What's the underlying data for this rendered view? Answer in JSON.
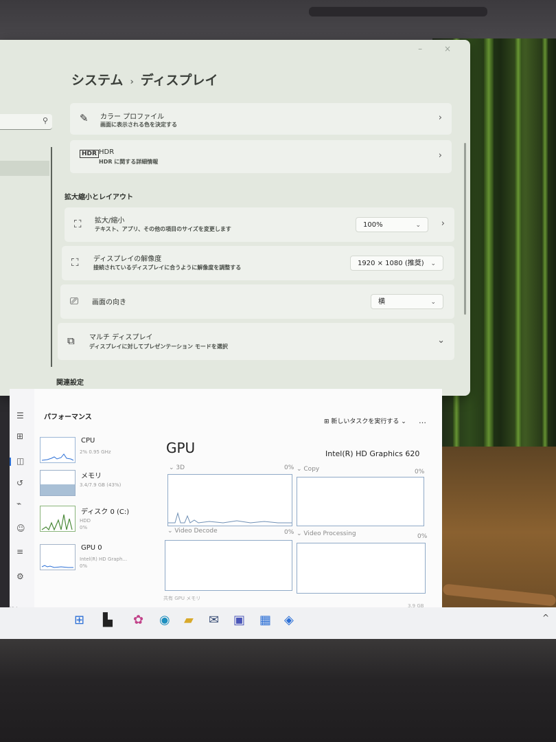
{
  "settings": {
    "breadcrumb": {
      "root": "システム",
      "sep": "›",
      "current": "ディスプレイ"
    },
    "cards": {
      "color_profile": {
        "title": "カラー プロファイル",
        "subtitle": "画面に表示される色を決定する",
        "icon": "pen-icon"
      },
      "hdr": {
        "title": "HDR",
        "subtitle": "HDR に関する詳細情報",
        "icon": "hdr-icon"
      }
    },
    "section_scale_layout": "拡大縮小とレイアウト",
    "scale": {
      "title": "拡大/縮小",
      "subtitle": "テキスト、アプリ、その他の項目のサイズを変更します",
      "value": "100%",
      "icon": "scale-icon"
    },
    "resolution": {
      "title": "ディスプレイの解像度",
      "subtitle": "接続されているディスプレイに合うように解像度を調整する",
      "value": "1920 × 1080 (推奨)",
      "icon": "resolution-icon"
    },
    "orientation": {
      "title": "画面の向き",
      "value": "横",
      "icon": "orientation-icon"
    },
    "multi": {
      "title": "マルチ ディスプレイ",
      "subtitle": "ディスプレイに対してプレゼンテーション モードを選択",
      "icon": "multi-display-icon"
    },
    "section_related": "関連設定"
  },
  "taskmgr": {
    "page_title": "パフォーマンス",
    "new_task": "新しいタスクを実行する",
    "more": "…",
    "sidebar": [
      {
        "name": "CPU",
        "stat": "2% 0.95 GHz"
      },
      {
        "name": "メモリ",
        "stat": "3.4/7.9 GB (43%)"
      },
      {
        "name": "ディスク 0 (C:)",
        "stat": "HDD",
        "stat2": "0%"
      },
      {
        "name": "GPU 0",
        "stat": "Intel(R) HD Graph...",
        "stat2": "0%"
      }
    ],
    "gpu_title": "GPU",
    "gpu_model": "Intel(R) HD Graphics 620",
    "graphs": [
      {
        "label": "⌄ 3D",
        "pct": "0%"
      },
      {
        "label": "⌄ Copy",
        "pct": "0%"
      },
      {
        "label": "⌄ Video Decode",
        "pct": "0%"
      },
      {
        "label": "⌄ Video Processing",
        "pct": "0%"
      }
    ],
    "footer_label": "共有 GPU メモリ",
    "footer_value": "3.9 GB",
    "status_left": "設定"
  },
  "taskbar": {
    "icons": [
      "start-icon",
      "widgets-icon",
      "copilot-icon",
      "edge-icon",
      "explorer-icon",
      "mail-icon",
      "teams-icon",
      "store-icon",
      "task-manager-icon"
    ],
    "tray": "^"
  }
}
